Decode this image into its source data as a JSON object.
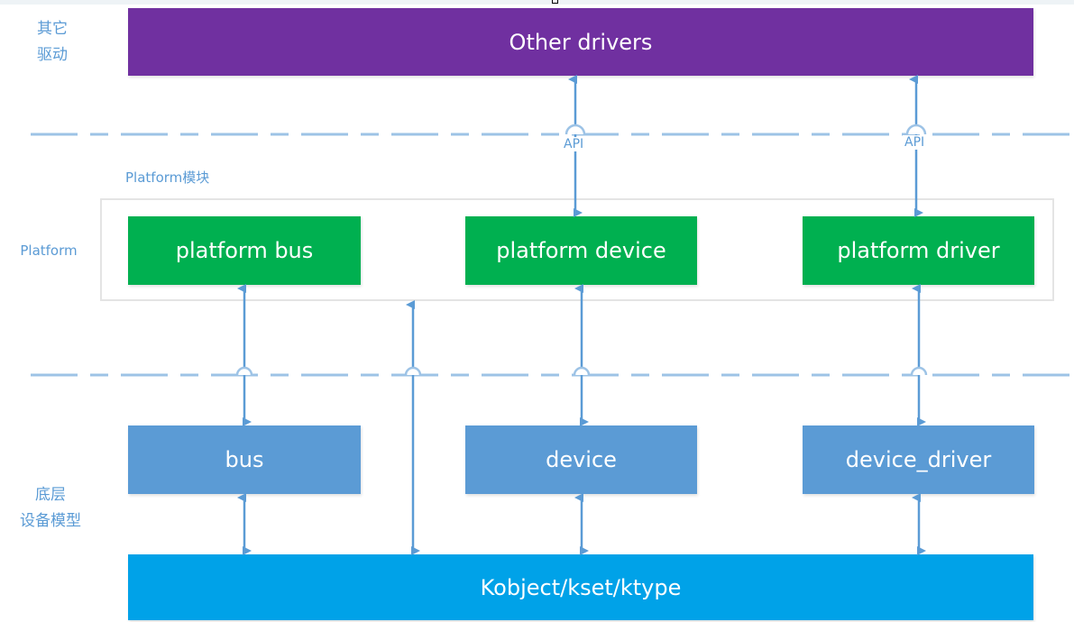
{
  "layers": {
    "other_drivers_label": "其它\n驱动",
    "platform_label": "Platform",
    "base_label": "底层\n设备模型"
  },
  "other_drivers": {
    "label": "Other drivers",
    "color": "#7030a0"
  },
  "platform_module": {
    "title": "Platform模块",
    "boxes": [
      {
        "label": "platform bus",
        "color": "#00b050"
      },
      {
        "label": "platform device",
        "color": "#00b050"
      },
      {
        "label": "platform driver",
        "color": "#00b050"
      }
    ]
  },
  "base_model": {
    "boxes": [
      {
        "label": "bus",
        "color": "#5b9bd5"
      },
      {
        "label": "device",
        "color": "#5b9bd5"
      },
      {
        "label": "device_driver",
        "color": "#5b9bd5"
      }
    ],
    "core": {
      "label": "Kobject/kset/ktype",
      "color": "#00a2e8"
    }
  },
  "connections": {
    "api_labels": [
      "API",
      "API"
    ],
    "arrow_color": "#5b9bd5",
    "links": [
      {
        "from": "Other drivers",
        "to": "platform device",
        "via": "API",
        "direction": "both"
      },
      {
        "from": "Other drivers",
        "to": "platform driver",
        "via": "API",
        "direction": "both"
      },
      {
        "from": "platform bus",
        "to": "bus",
        "direction": "both"
      },
      {
        "from": "Kobject/kset/ktype",
        "to": "Platform",
        "direction": "both"
      },
      {
        "from": "platform device",
        "to": "device",
        "direction": "both"
      },
      {
        "from": "platform driver",
        "to": "device_driver",
        "direction": "both"
      },
      {
        "from": "bus",
        "to": "Kobject/kset/ktype",
        "direction": "both"
      },
      {
        "from": "device",
        "to": "Kobject/kset/ktype",
        "direction": "both"
      },
      {
        "from": "device_driver",
        "to": "Kobject/kset/ktype",
        "direction": "both"
      }
    ]
  }
}
